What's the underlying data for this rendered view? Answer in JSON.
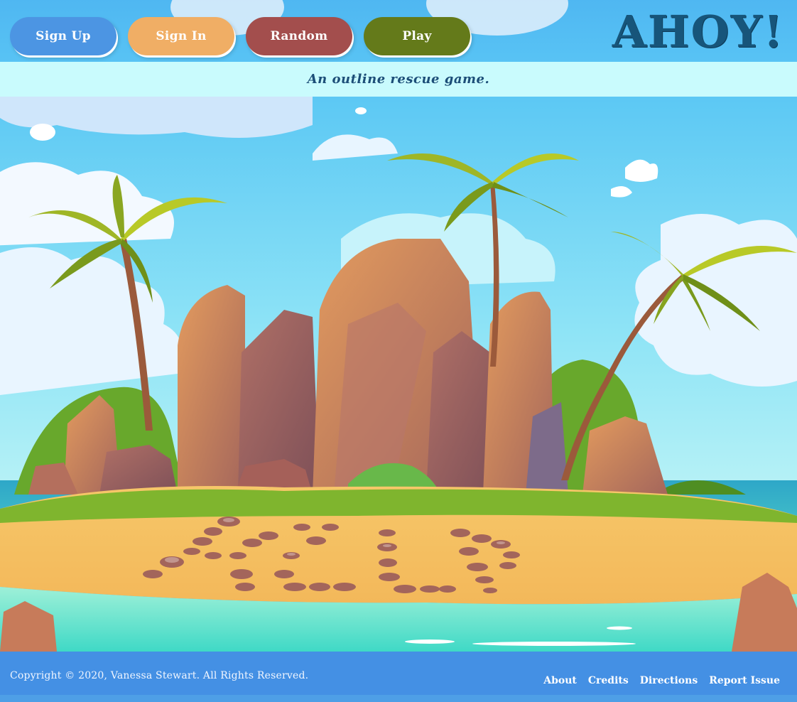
{
  "nav": {
    "buttons": [
      {
        "label": "Sign Up",
        "color": "#4c95e3"
      },
      {
        "label": "Sign In",
        "color": "#f0ae65"
      },
      {
        "label": "Random",
        "color": "#a34e4d"
      },
      {
        "label": "Play",
        "color": "#647a1a"
      }
    ]
  },
  "logo": {
    "text": "AHOY!",
    "color": "#17557a"
  },
  "tagline": {
    "text": "An outline rescue game."
  },
  "hero": {
    "illustration": "island-help-scene"
  },
  "footer": {
    "copyright": "Copyright © 2020, Vanessa Stewart. All Rights Reserved.",
    "links": [
      "About",
      "Credits",
      "Directions",
      "Report Issue"
    ]
  },
  "colors": {
    "header_bg": "#58c3f4",
    "tagline_bg": "#c9fbfd",
    "footer_bg": "#4490e4"
  }
}
